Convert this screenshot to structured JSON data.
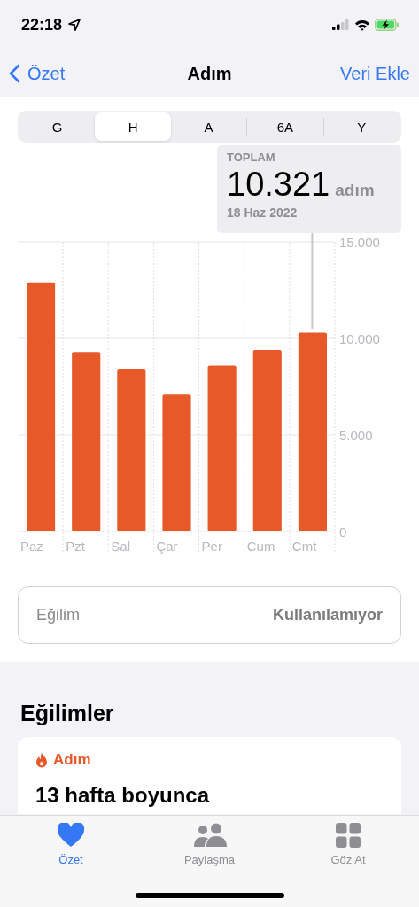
{
  "status_bar": {
    "time": "22:18"
  },
  "nav": {
    "back": "Özet",
    "title": "Adım",
    "action": "Veri Ekle"
  },
  "segments": [
    {
      "label": "G",
      "selected": false
    },
    {
      "label": "H",
      "selected": true
    },
    {
      "label": "A",
      "selected": false
    },
    {
      "label": "6A",
      "selected": false
    },
    {
      "label": "Y",
      "selected": false
    }
  ],
  "summary": {
    "label": "TOPLAM",
    "value": "10.321",
    "unit": "adım",
    "date": "18 Haz 2022"
  },
  "chart_data": {
    "type": "bar",
    "categories": [
      "Paz",
      "Pzt",
      "Sal",
      "Çar",
      "Per",
      "Cum",
      "Cmt"
    ],
    "series": [
      {
        "color": "#e8592a",
        "values": [
          12900,
          9300,
          8400,
          7100,
          8600,
          9400,
          10300
        ]
      }
    ],
    "ylim": [
      0,
      15000
    ],
    "yticks": [
      {
        "value": 0,
        "label": "0"
      },
      {
        "value": 5000,
        "label": "5.000"
      },
      {
        "value": 10000,
        "label": "10.000"
      },
      {
        "value": 15000,
        "label": "15.000"
      }
    ]
  },
  "trend_row": {
    "label": "Eğilim",
    "value": "Kullanılamıyor"
  },
  "trends": {
    "title": "Eğilimler",
    "card": {
      "category": "Adım",
      "headline": "13 hafta boyunca"
    }
  },
  "tab_bar": [
    {
      "label": "Özet",
      "selected": true
    },
    {
      "label": "Paylaşma",
      "selected": false
    },
    {
      "label": "Göz At",
      "selected": false
    }
  ]
}
